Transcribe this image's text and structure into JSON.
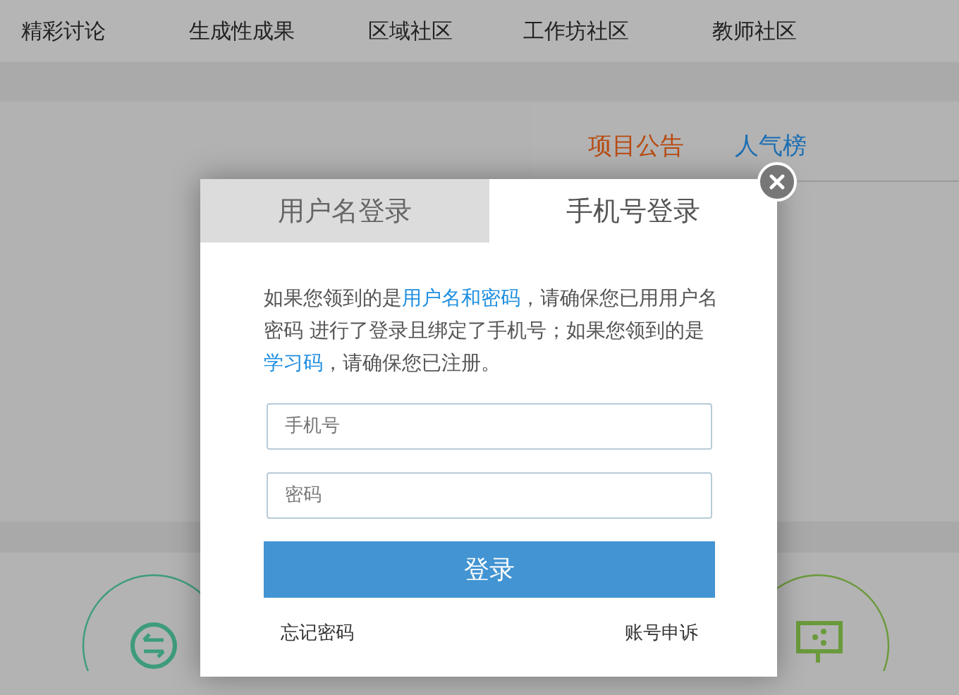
{
  "nav": [
    {
      "label": "精彩讨论"
    },
    {
      "label": "生成性成果"
    },
    {
      "label": "区域社区"
    },
    {
      "label": "工作坊社区"
    },
    {
      "label": "教师社区"
    }
  ],
  "side_tabs": [
    {
      "label": "项目公告",
      "selected": true
    },
    {
      "label": "人气榜",
      "selected": false
    }
  ],
  "modal": {
    "tabs": [
      {
        "label": "用户名登录",
        "selected": false
      },
      {
        "label": "手机号登录",
        "selected": true
      }
    ],
    "notice": [
      {
        "text": "如果您领到的是",
        "highlight": false
      },
      {
        "text": "用户名和密码",
        "highlight": true
      },
      {
        "text": "，请确保您已用用户名密码 进行了登录且绑定了手机号；如果您领到的是",
        "highlight": false
      },
      {
        "text": "学习码",
        "highlight": true
      },
      {
        "text": "，请确保您已注册。",
        "highlight": false
      }
    ],
    "fields": [
      {
        "placeholder": "手机号"
      },
      {
        "placeholder": "密码"
      }
    ],
    "submit": "登录",
    "links": [
      "忘记密码",
      "账号申诉"
    ]
  }
}
